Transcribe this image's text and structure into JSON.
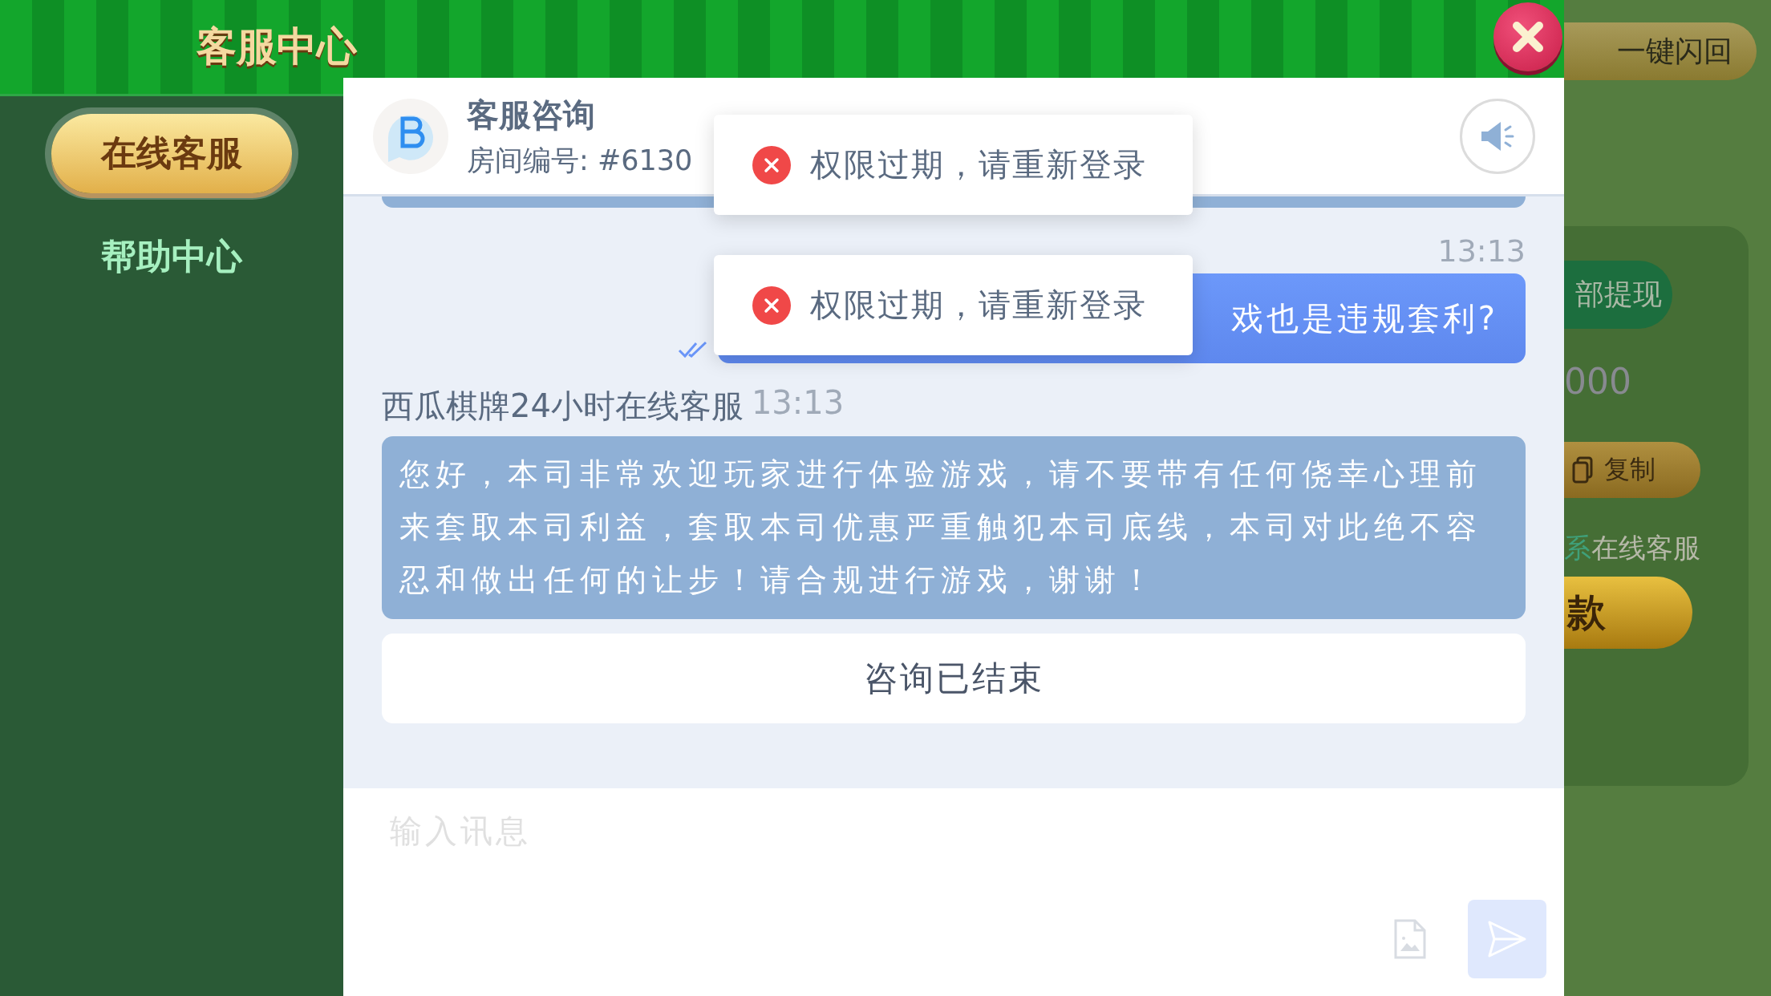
{
  "header": {
    "title": "客服中心"
  },
  "sidebar": {
    "items": [
      {
        "label": "在线客服",
        "selected": true
      },
      {
        "label": "帮助中心",
        "selected": false
      }
    ]
  },
  "background_panel": {
    "quick_return_button": "一键闪回",
    "withdraw_button": "部提现",
    "amount": "000",
    "copy_button": "复制",
    "contact_link": "系",
    "contact_text": "在线客服",
    "action_button": "款"
  },
  "chat": {
    "title": "客服咨询",
    "room_number": "房间编号: #6130",
    "messages": [
      {
        "kind": "partial"
      },
      {
        "kind": "outgoing",
        "time": "13:13",
        "text": "戏也是违规套利?",
        "read": true
      },
      {
        "kind": "incoming",
        "sender": "西瓜棋牌24小时在线客服",
        "time": "13:13",
        "text": "您好，本司非常欢迎玩家进行体验游戏，请不要带有任何侥幸心理前来套取本司利益，套取本司优惠严重触犯本司底线，本司对此绝不容忍和做出任何的让步！请合规进行游戏，谢谢！"
      }
    ],
    "status_notice": "咨询已结束",
    "input": {
      "placeholder": "输入讯息"
    }
  },
  "toasts": [
    {
      "kind": "error",
      "text": "权限过期，请重新登录"
    },
    {
      "kind": "error",
      "text": "权限过期，请重新登录"
    }
  ]
}
